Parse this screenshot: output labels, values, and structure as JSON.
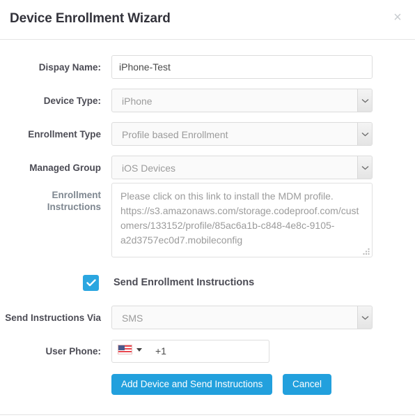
{
  "modal": {
    "title": "Device Enrollment Wizard",
    "close_icon": "close-icon",
    "close_glyph": "×"
  },
  "form": {
    "display_name": {
      "label": "Dispay Name:",
      "value": "iPhone-Test",
      "placeholder": ""
    },
    "device_type": {
      "label": "Device Type:",
      "value": "iPhone"
    },
    "enrollment_type": {
      "label": "Enrollment Type",
      "value": "Profile based Enrollment"
    },
    "managed_group": {
      "label": "Managed Group",
      "value": "iOS Devices"
    },
    "enrollment_instructions": {
      "label_line1": "Enrollment",
      "label_line2": "Instructions",
      "value": "Please click on this link to install the MDM profile. https://s3.amazonaws.com/storage.codeproof.com/customers/133152/profile/85ac6a1b-c848-4e8c-9105-a2d3757ec0d7.mobileconfig"
    },
    "send_enrollment_instructions": {
      "label": "Send Enrollment Instructions",
      "checked": "true"
    },
    "send_instructions_via": {
      "label": "Send Instructions Via",
      "value": "SMS"
    },
    "user_phone": {
      "label": "User Phone:",
      "country_flag": "us-flag-icon",
      "value": "+1",
      "placeholder": ""
    }
  },
  "actions": {
    "submit_label": "Add Device and Send Instructions",
    "cancel_label": "Cancel"
  },
  "colors": {
    "accent": "#22a0dd",
    "checkbox": "#2ba6e0",
    "label_text": "#4c4c55",
    "muted_text": "#9b9b9b",
    "border": "#dddddd"
  }
}
